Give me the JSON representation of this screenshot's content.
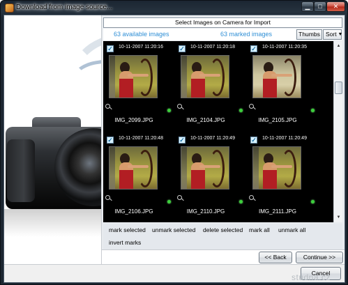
{
  "window": {
    "title": "Download from image source...",
    "controls": {
      "minimize": "▁",
      "maximize": "□",
      "close": "✕"
    }
  },
  "header": {
    "title": "Select Images on Camera for Import",
    "available": "63 available images",
    "marked": "63 marked images",
    "thumbs_label": "Thumbs",
    "sort_label": "Sort"
  },
  "images": [
    {
      "timestamp": "10-11-2007 11:20:16",
      "filename": "IMG_2099.JPG",
      "checked": true
    },
    {
      "timestamp": "10-11-2007 11:20:18",
      "filename": "IMG_2104.JPG",
      "checked": true
    },
    {
      "timestamp": "10-11-2007 11:20:35",
      "filename": "IMG_2105.JPG",
      "checked": true
    },
    {
      "timestamp": "10-11-2007 11:20:48",
      "filename": "IMG_2106.JPG",
      "checked": true
    },
    {
      "timestamp": "10-11-2007 11:20:49",
      "filename": "IMG_2110.JPG",
      "checked": true
    },
    {
      "timestamp": "10-11-2007 11:20:49",
      "filename": "IMG_2111.JPG",
      "checked": true
    }
  ],
  "actions": {
    "mark_selected": "mark selected",
    "unmark_selected": "unmark selected",
    "delete_selected": "delete selected",
    "mark_all": "mark all",
    "unmark_all": "unmark all",
    "invert_marks": "invert marks"
  },
  "nav": {
    "back": "<< Back",
    "continue": "Continue >>",
    "cancel": "Cancel"
  },
  "watermark": "studna.cz",
  "colors": {
    "link": "#2f8fd6",
    "grid_bg": "#000000",
    "marked_dot": "#3ccf3c"
  }
}
